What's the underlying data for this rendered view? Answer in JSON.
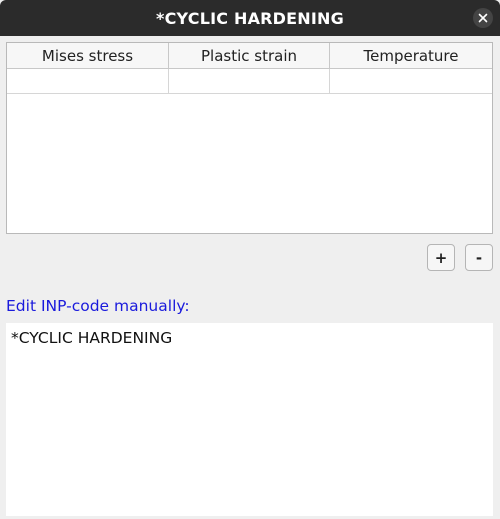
{
  "window": {
    "title": "*CYCLIC HARDENING"
  },
  "table": {
    "columns": [
      "Mises stress",
      "Plastic strain",
      "Temperature"
    ],
    "rows": [
      [
        "",
        "",
        ""
      ]
    ]
  },
  "buttons": {
    "add_label": "+",
    "remove_label": "-"
  },
  "editor": {
    "label": "Edit INP-code manually:",
    "content": "*CYCLIC HARDENING"
  },
  "colors": {
    "titlebar": "#2b2b2b",
    "label_accent": "#1a1adc",
    "background": "#efefef"
  }
}
